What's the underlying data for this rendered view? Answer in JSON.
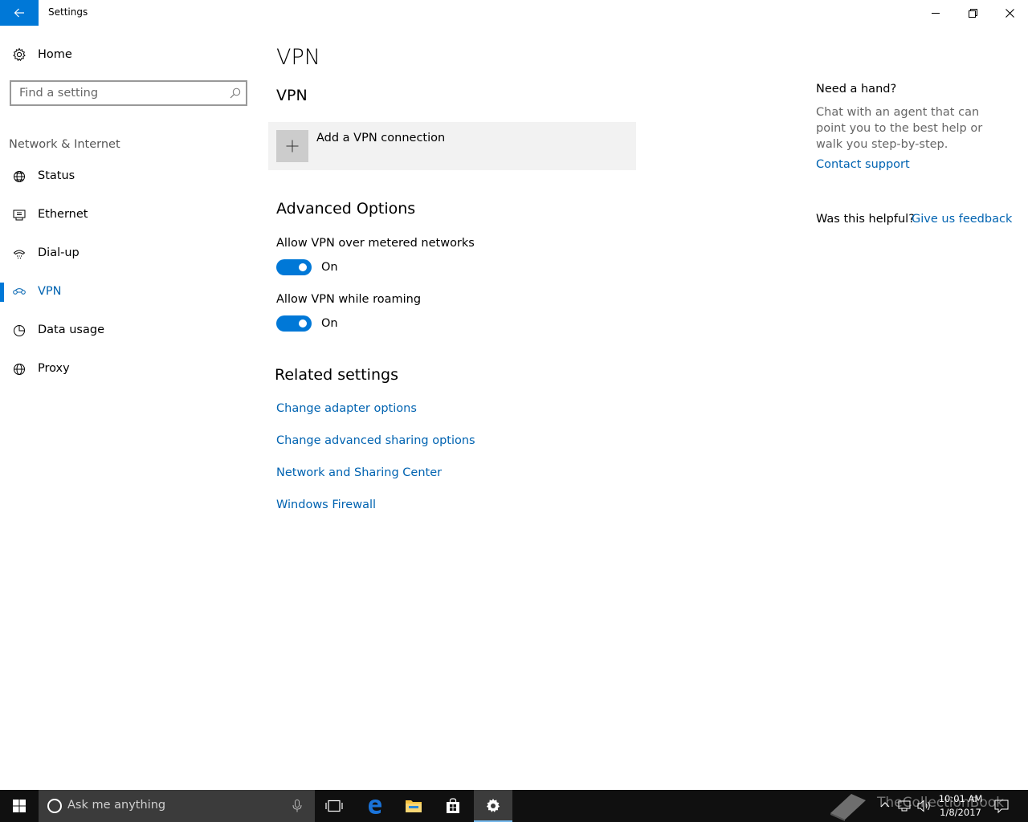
{
  "window": {
    "title": "Settings"
  },
  "nav": {
    "home_label": "Home",
    "search_placeholder": "Find a setting",
    "section_label": "Network & Internet",
    "items": [
      {
        "label": "Status",
        "icon": "globe-status-icon"
      },
      {
        "label": "Ethernet",
        "icon": "ethernet-icon"
      },
      {
        "label": "Dial-up",
        "icon": "dial-up-icon"
      },
      {
        "label": "VPN",
        "icon": "vpn-icon",
        "selected": true
      },
      {
        "label": "Data usage",
        "icon": "data-usage-icon"
      },
      {
        "label": "Proxy",
        "icon": "globe-icon"
      }
    ]
  },
  "main": {
    "page_title": "VPN",
    "vpn_section_title": "VPN",
    "add_vpn_label": "Add a VPN connection",
    "advanced_title": "Advanced Options",
    "options": [
      {
        "label": "Allow VPN over metered networks",
        "state": "On",
        "enabled": true
      },
      {
        "label": "Allow VPN while roaming",
        "state": "On",
        "enabled": true
      }
    ],
    "related_title": "Related settings",
    "related_links": [
      "Change adapter options",
      "Change advanced sharing options",
      "Network and Sharing Center",
      "Windows Firewall"
    ]
  },
  "help": {
    "title": "Need a hand?",
    "text": "Chat with an agent that can point you to the best help or walk you step-by-step.",
    "contact_link": "Contact support",
    "helpful_question": "Was this helpful?",
    "feedback_link": "Give us feedback"
  },
  "taskbar": {
    "search_placeholder": "Ask me anything",
    "time": "10:01 AM",
    "date": "1/8/2017",
    "watermark": "TheCollectionBook"
  },
  "colors": {
    "accent": "#0078d7",
    "link": "#0063b1",
    "taskbar": "#101010"
  }
}
